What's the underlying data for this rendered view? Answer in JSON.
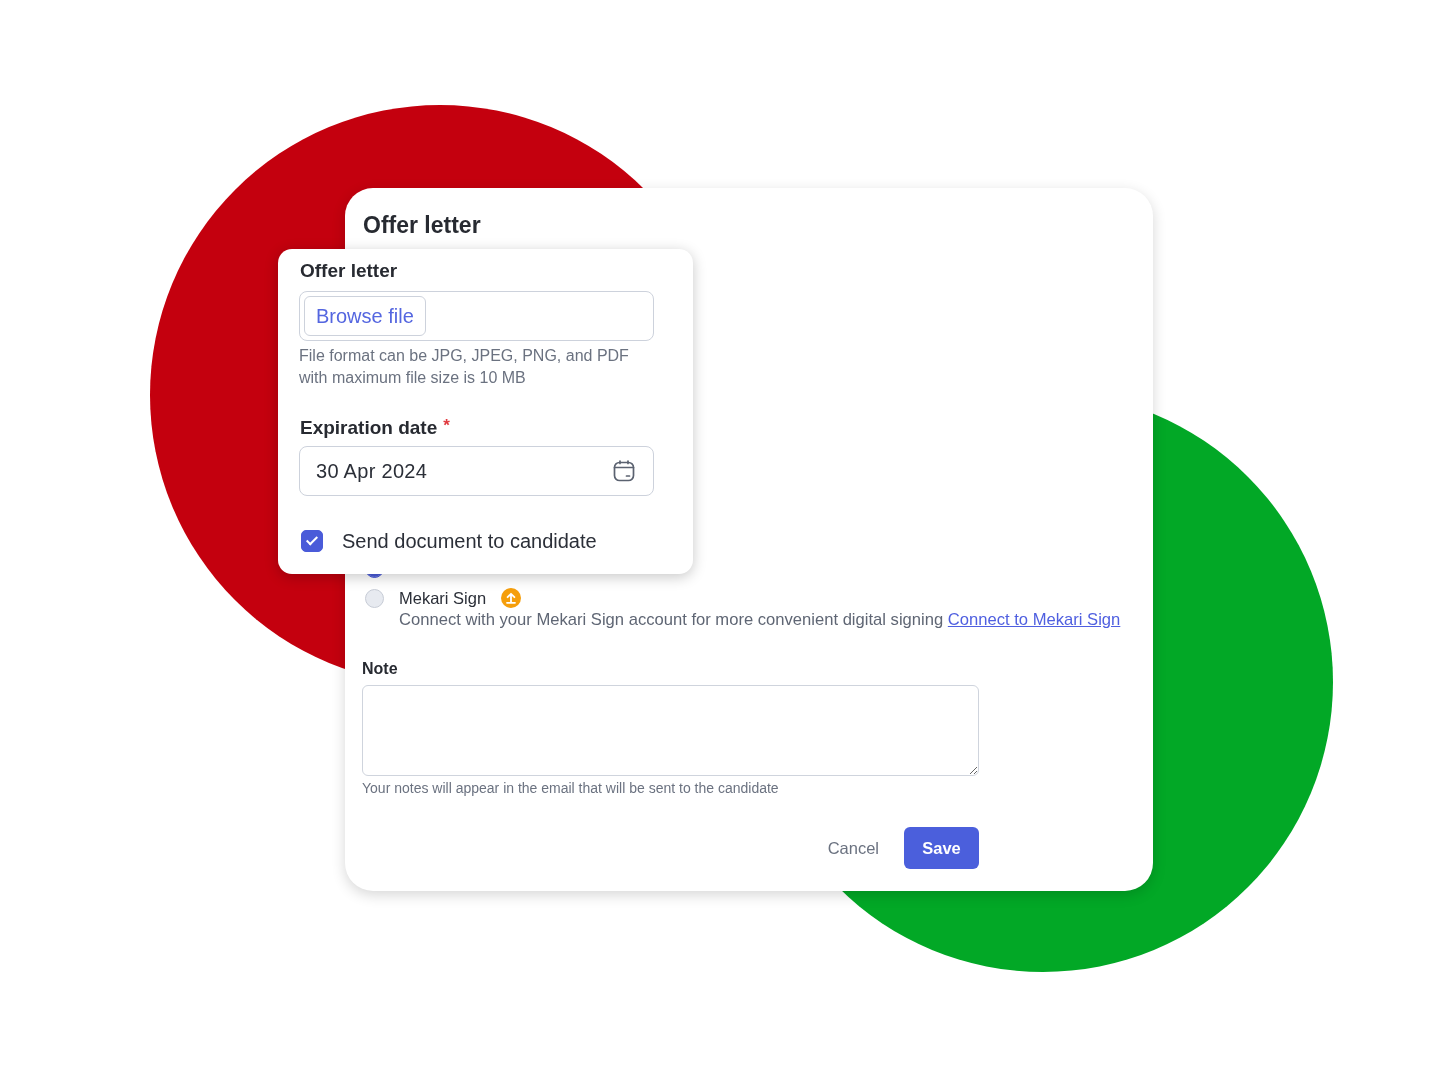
{
  "dialog": {
    "title": "Offer letter",
    "signing_options": [
      {
        "selected": true
      },
      {
        "label": "Mekari Sign",
        "selected": false,
        "description": "Connect with your Mekari Sign account for more convenient digital signing",
        "link": "Connect to Mekari Sign"
      }
    ],
    "note": {
      "label": "Note",
      "help": "Your notes will appear in the email that will be sent to the candidate"
    },
    "buttons": [
      {
        "label": "Cancel",
        "kind": "secondary"
      },
      {
        "label": "Save",
        "kind": "primary"
      }
    ]
  },
  "upload_panel": {
    "file": {
      "label": "Offer letter",
      "button": "Browse file",
      "help": "File format can be JPG, JPEG, PNG, and PDF with maximum file size is 10 MB"
    },
    "expiration_date": {
      "label": "Expiration date",
      "required_mark": "*",
      "value": "30 Apr 2024"
    },
    "send_to_candidate": {
      "label": "Send document to candidate",
      "checked": true
    }
  }
}
